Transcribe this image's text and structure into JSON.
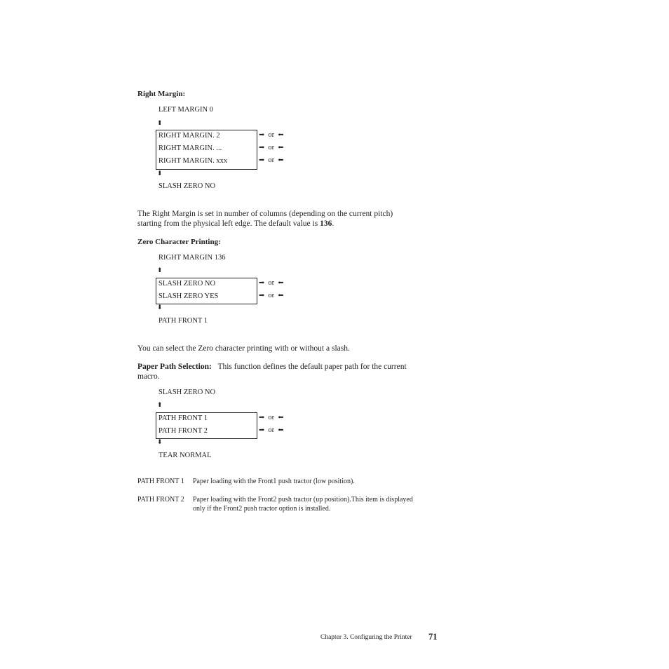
{
  "sections": {
    "right_margin": {
      "heading": "Right Margin:",
      "prev": "LEFT MARGIN 0",
      "options": [
        "RIGHT MARGIN. 2",
        "RIGHT MARGIN. ...",
        "RIGHT MARGIN. xxx"
      ],
      "next": "SLASH ZERO NO",
      "paragraph_line1": "The Right Margin is set in number of columns (depending on the current pitch)",
      "paragraph_line2_pre": "starting from the physical left edge. The default value is ",
      "paragraph_default": "136",
      "paragraph_line2_post": "."
    },
    "zero_char": {
      "heading": "Zero Character Printing:",
      "prev": "RIGHT MARGIN 136",
      "options": [
        "SLASH ZERO NO",
        "SLASH ZERO YES"
      ],
      "next": "PATH FRONT 1",
      "paragraph": "You can select the Zero character printing with or without a slash."
    },
    "paper_path": {
      "heading": "Paper Path Selection:",
      "intro_line1": "This function defines the default paper path for the current",
      "intro_line2": "macro.",
      "prev": "SLASH ZERO NO",
      "options": [
        "PATH FRONT 1",
        "PATH FRONT 2"
      ],
      "next": "TEAR NORMAL",
      "definitions": [
        {
          "term": "PATH FRONT 1",
          "desc": "Paper loading with the Front1 push tractor (low position)."
        },
        {
          "term": "PATH FRONT 2",
          "desc": "Paper loading with the Front2 push tractor (up position).This item is displayed only if the Front2 push tractor option is installed."
        }
      ]
    }
  },
  "nav": {
    "or_label": "or",
    "right_arrow": "➡",
    "left_arrow": "⬅",
    "up_arrow": "⬆",
    "down_arrow": "⬇"
  },
  "footer": {
    "chapter": "Chapter 3. Configuring the Printer",
    "page_number": "71"
  }
}
